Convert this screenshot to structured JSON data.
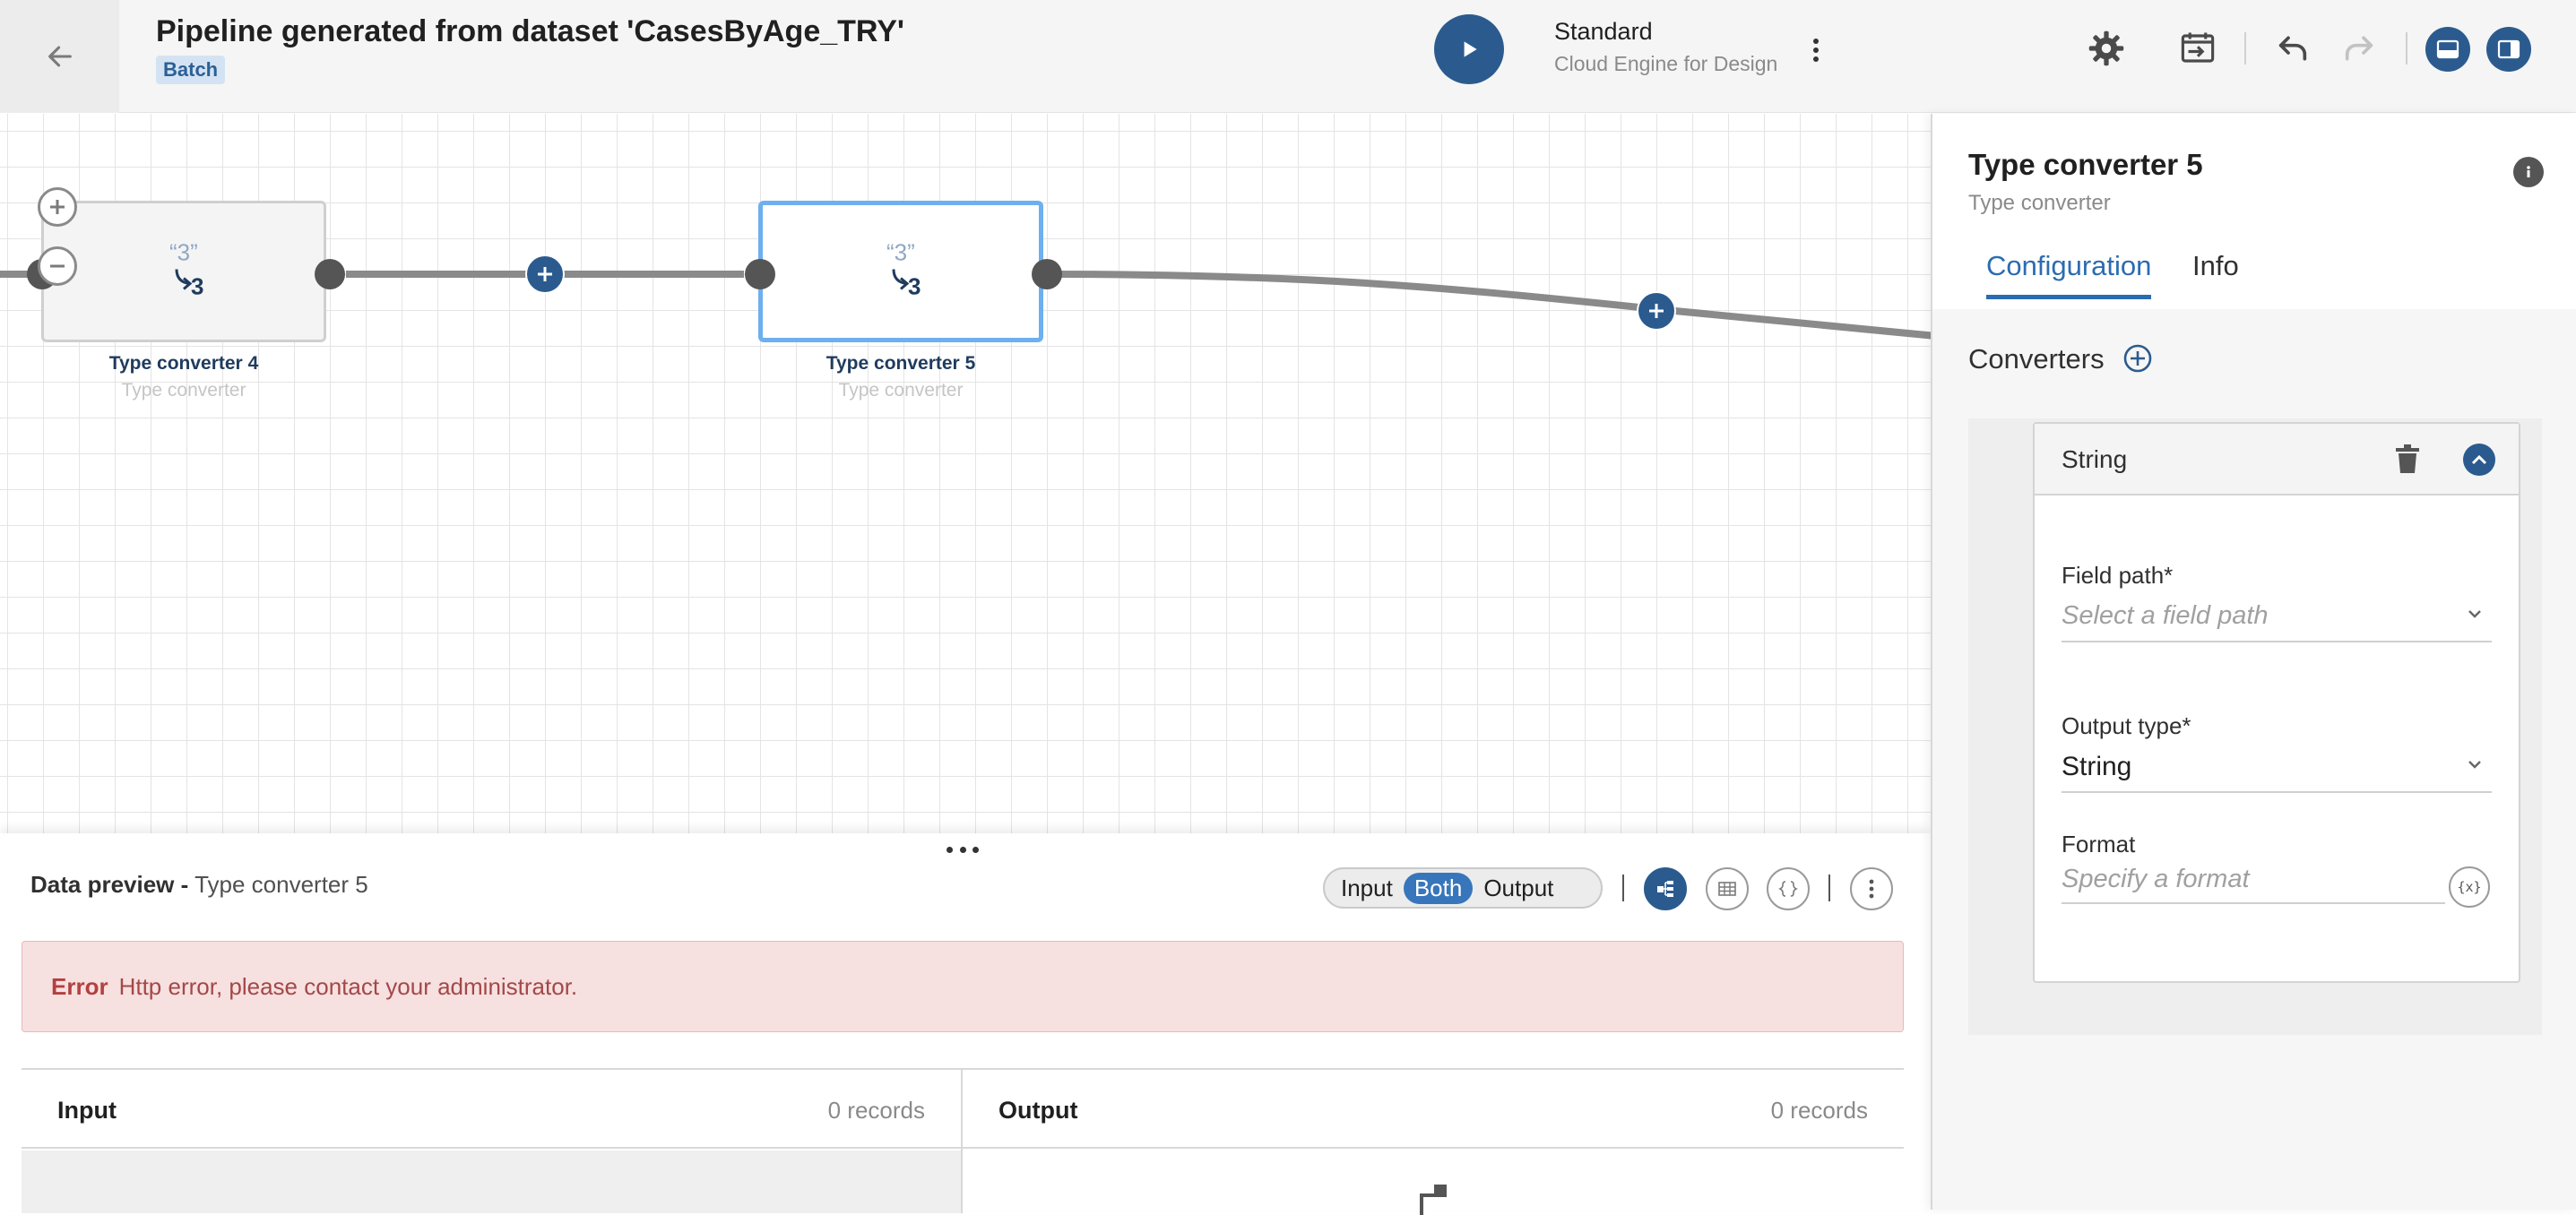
{
  "header": {
    "title": "Pipeline generated from dataset 'CasesByAge_TRY'",
    "badge": "Batch",
    "engine_name": "Standard",
    "engine_sub": "Cloud Engine for Design",
    "icons": [
      "back-arrow-icon",
      "play-icon",
      "more-vertical-icon",
      "gear-icon",
      "run-profile-icon",
      "undo-icon",
      "redo-icon",
      "bottom-panel-icon",
      "side-panel-icon"
    ]
  },
  "canvas": {
    "nodes": [
      {
        "label": "Type converter 4",
        "sub": "Type converter",
        "selected": false
      },
      {
        "label": "Type converter 5",
        "sub": "Type converter",
        "selected": true
      }
    ],
    "glyph": {
      "quote": "“3”",
      "num": "3"
    }
  },
  "preview": {
    "title_bold": "Data preview -",
    "title_rest": "Type converter 5",
    "modes": [
      "Input",
      "Both",
      "Output"
    ],
    "active_mode": "Both",
    "error_label": "Error",
    "error_message": "Http error, please contact your administrator.",
    "input_header": "Input",
    "input_count": "0 records",
    "output_header": "Output",
    "output_count": "0 records"
  },
  "panel": {
    "title": "Type converter 5",
    "subtitle": "Type converter",
    "tabs": [
      "Configuration",
      "Info"
    ],
    "active_tab": "Configuration",
    "converters_label": "Converters",
    "converter": {
      "title": "String",
      "field_path_label": "Field path*",
      "field_path_placeholder": "Select a field path",
      "output_type_label": "Output type*",
      "output_type_value": "String",
      "format_label": "Format",
      "format_placeholder": "Specify a format",
      "var_button": "{x}"
    }
  },
  "colors": {
    "primary": "#2b5b8e",
    "accent": "#2b6cb0",
    "selected_border": "#6db0ef",
    "error_bg": "#f7e0e0",
    "error_text": "#a34848"
  }
}
